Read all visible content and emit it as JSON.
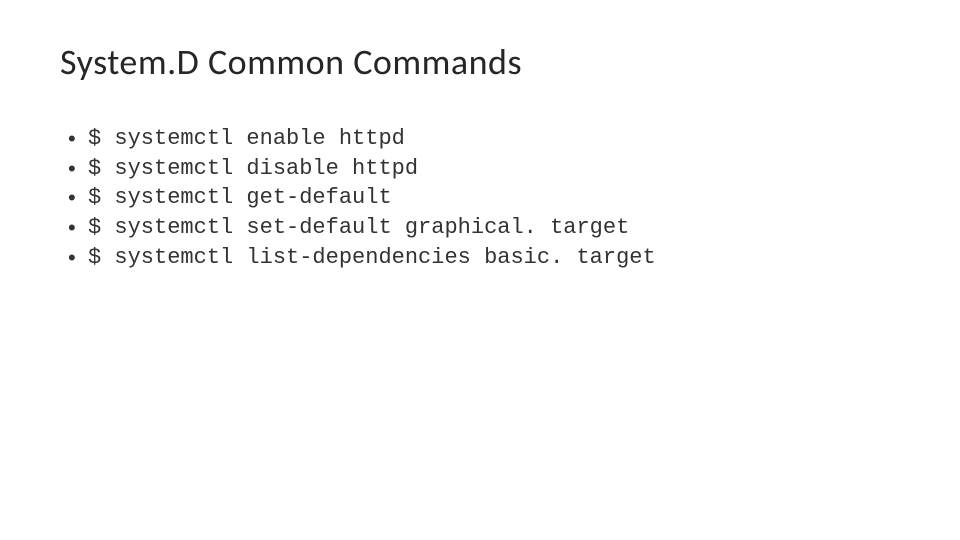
{
  "title": "System.D Common Commands",
  "commands": [
    "$ systemctl enable httpd",
    "$ systemctl disable httpd",
    "$ systemctl get-default",
    "$ systemctl set-default graphical. target",
    "$ systemctl list-dependencies basic. target"
  ]
}
